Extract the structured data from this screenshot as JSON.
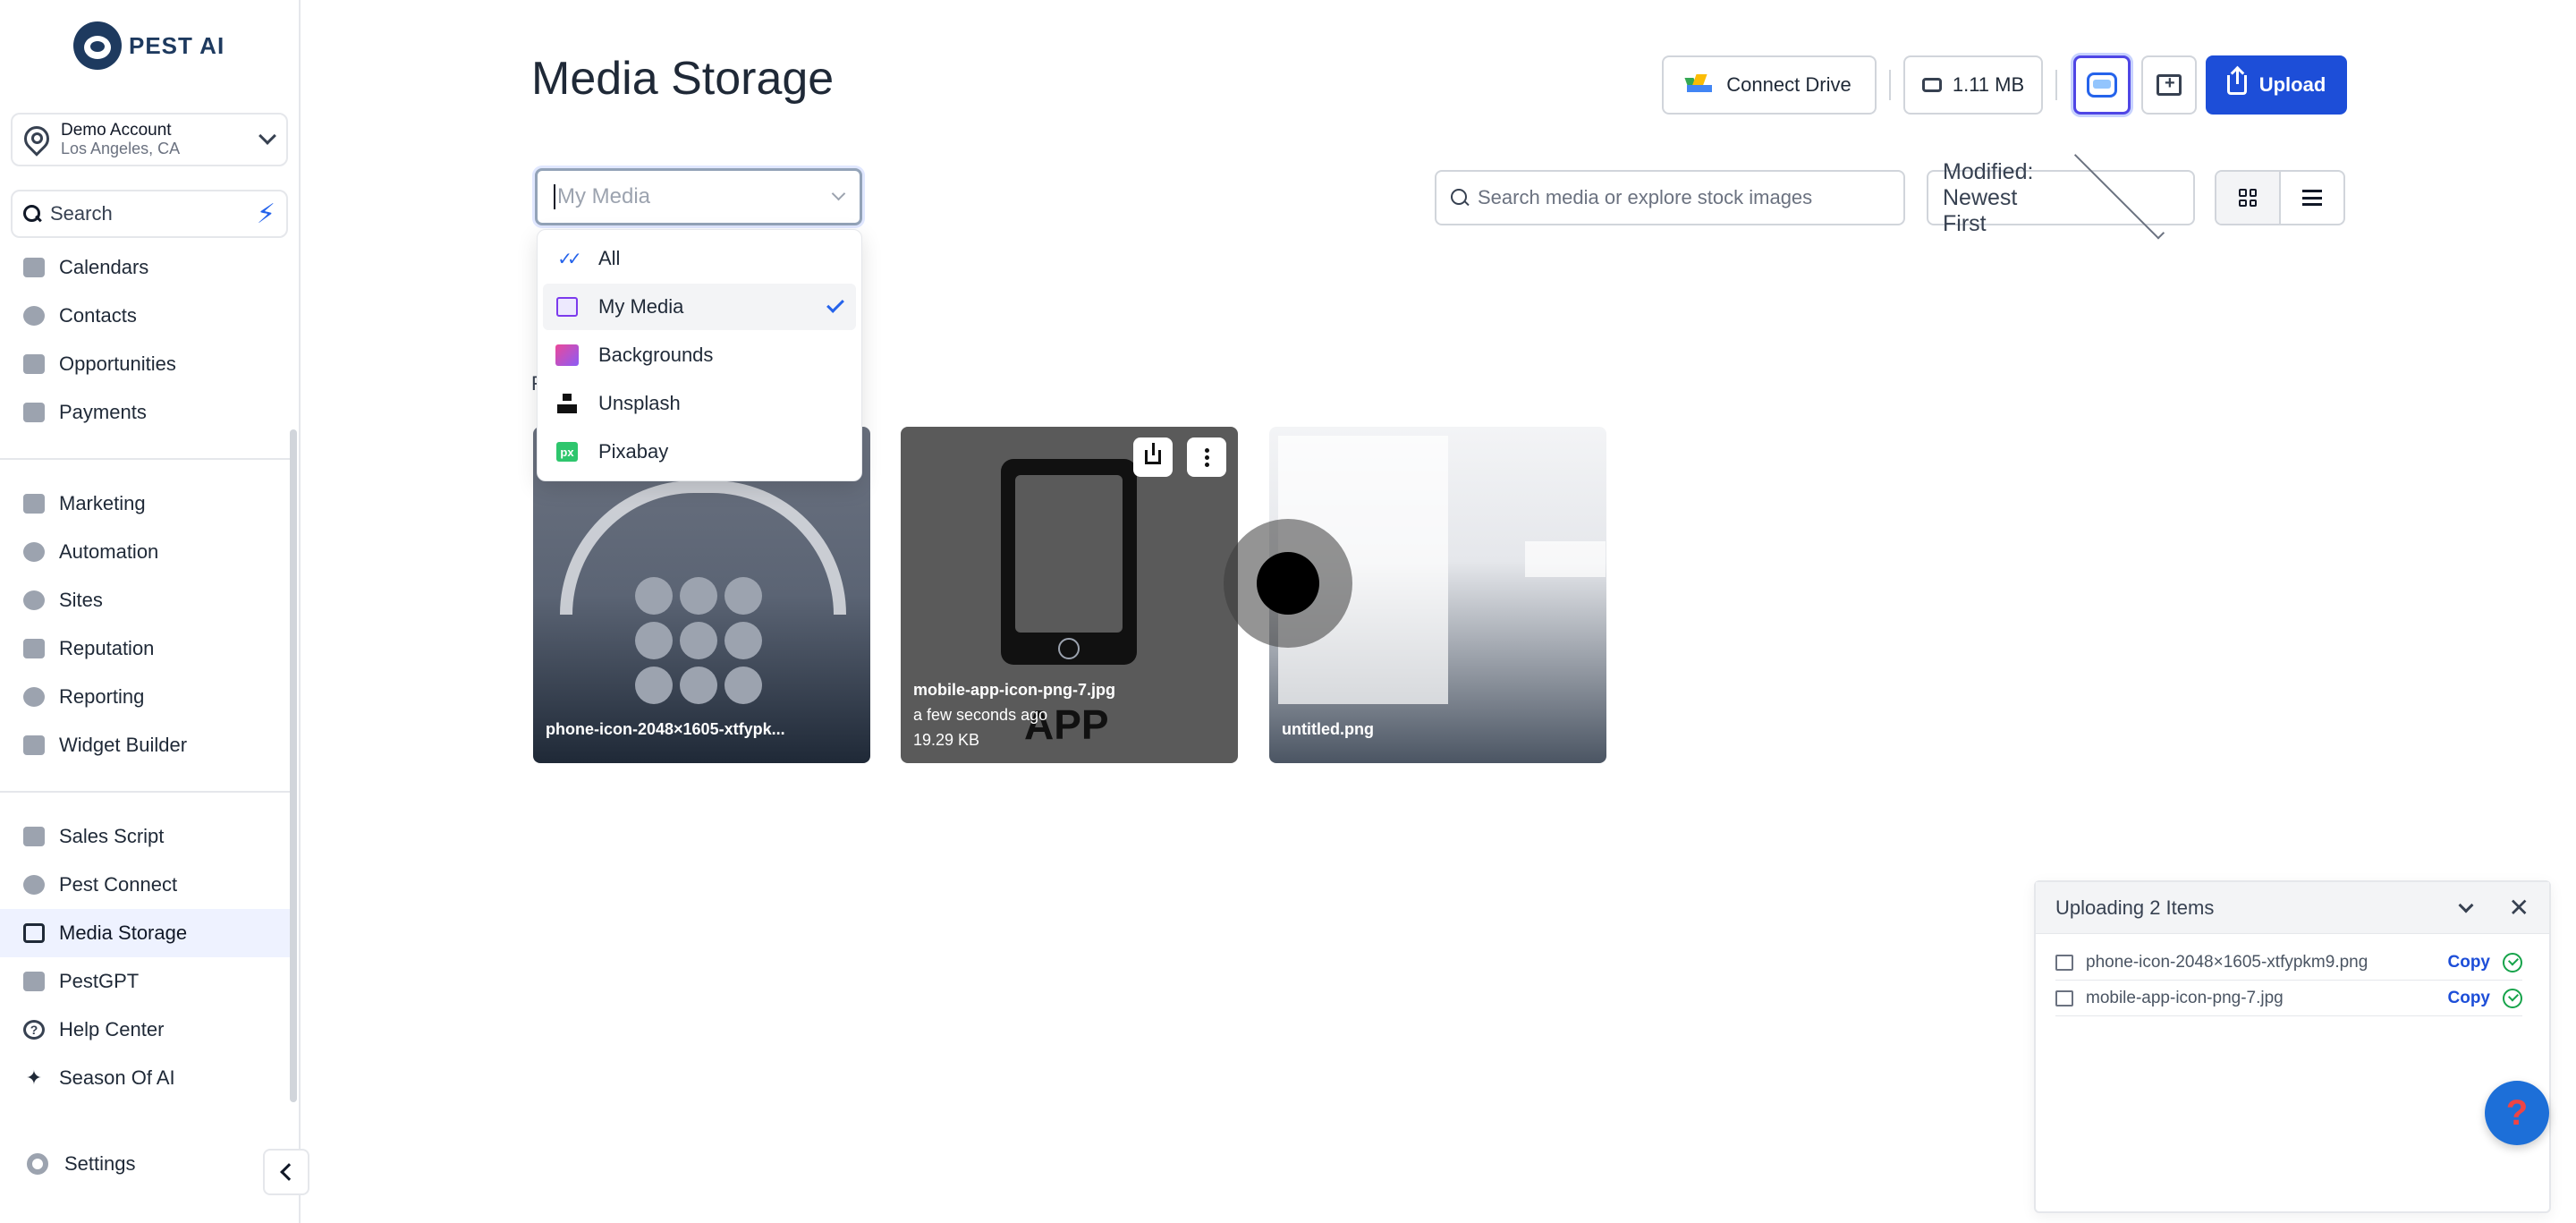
{
  "brand": {
    "name": "PEST AI"
  },
  "account": {
    "name": "Demo Account",
    "location": "Los Angeles, CA"
  },
  "sidebar": {
    "search_label": "Search",
    "group1": [
      {
        "label": "Calendars",
        "icon": "calendar-icon"
      },
      {
        "label": "Contacts",
        "icon": "person-icon"
      },
      {
        "label": "Opportunities",
        "icon": "filter-icon"
      },
      {
        "label": "Payments",
        "icon": "card-icon"
      }
    ],
    "group2": [
      {
        "label": "Marketing",
        "icon": "megaphone-icon"
      },
      {
        "label": "Automation",
        "icon": "automation-icon"
      },
      {
        "label": "Sites",
        "icon": "sites-icon"
      },
      {
        "label": "Reputation",
        "icon": "star-icon"
      },
      {
        "label": "Reporting",
        "icon": "pie-icon"
      },
      {
        "label": "Widget Builder",
        "icon": "widget-icon"
      }
    ],
    "group3": [
      {
        "label": "Sales Script",
        "icon": "script-icon"
      },
      {
        "label": "Pest Connect",
        "icon": "connect-icon"
      },
      {
        "label": "Media Storage",
        "icon": "image-icon",
        "active": true
      },
      {
        "label": "PestGPT",
        "icon": "robot-icon"
      },
      {
        "label": "Help Center",
        "icon": "help-icon"
      },
      {
        "label": "Season Of AI",
        "icon": "sparkle-icon"
      }
    ],
    "settings_label": "Settings"
  },
  "header": {
    "title": "Media Storage",
    "connect_drive": "Connect Drive",
    "storage_used": "1.11 MB",
    "upload": "Upload"
  },
  "filters": {
    "source_placeholder": "My Media",
    "search_placeholder": "Search media or explore stock images",
    "sort": "Modified: Newest First"
  },
  "source_menu": [
    {
      "label": "All",
      "icon": "double-check-icon"
    },
    {
      "label": "My Media",
      "icon": "image-icon",
      "selected": true
    },
    {
      "label": "Backgrounds",
      "icon": "gradient-icon"
    },
    {
      "label": "Unsplash",
      "icon": "unsplash-icon"
    },
    {
      "label": "Pixabay",
      "icon": "pixabay-icon"
    }
  ],
  "media": [
    {
      "name": "phone-icon-2048×1605-xtfypk..."
    },
    {
      "name": "mobile-app-icon-png-7.jpg",
      "time": "a few seconds ago",
      "size": "19.29 KB",
      "overlay_text": "APP"
    },
    {
      "name": "untitled.png"
    }
  ],
  "hidden_text": "F",
  "upload_panel": {
    "title": "Uploading 2 Items",
    "copy_label": "Copy",
    "items": [
      {
        "name": "phone-icon-2048×1605-xtfypkm9.png"
      },
      {
        "name": "mobile-app-icon-png-7.jpg"
      }
    ]
  },
  "colors": {
    "primary": "#1d4ed8",
    "active_bg": "#eef2ff",
    "success": "#16a34a"
  }
}
